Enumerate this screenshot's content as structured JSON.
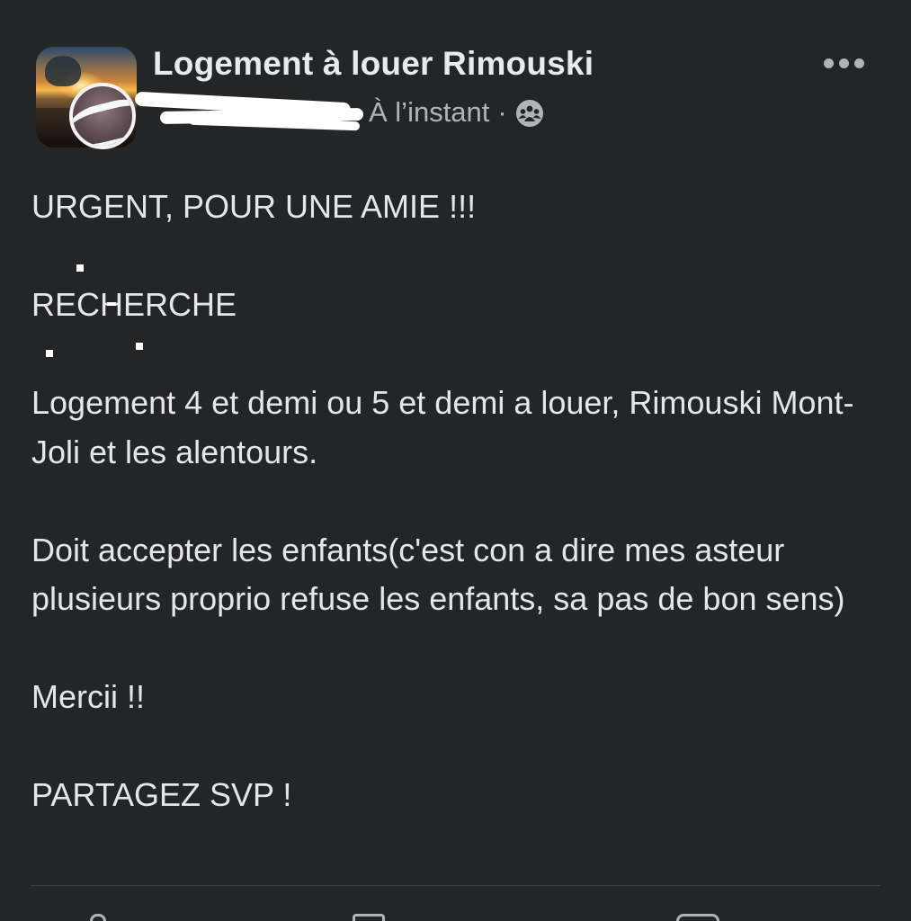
{
  "post": {
    "group_name": "Logement à louer Rimouski",
    "timestamp": "À l’instant",
    "separator": "·",
    "audience_icon": "group-audience-icon",
    "more_icon": "more-options-icon",
    "body": {
      "line1": "URGENT, POUR UNE AMIE !!!",
      "line2": "RECHERCHE",
      "line3": "Logement 4 et demi ou 5 et demi a louer, Rimouski Mont-Joli et les alentours.",
      "line4": "Doit accepter les enfants(c'est con a dire mes asteur plusieurs proprio refuse les enfants, sa pas de bon sens)",
      "line5": "Mercii !!",
      "line6": "PARTAGEZ SVP !"
    }
  },
  "colors": {
    "background": "#242526",
    "text_primary": "#e4e6eb",
    "text_secondary": "#b0b3b8",
    "divider": "#3e4042"
  }
}
